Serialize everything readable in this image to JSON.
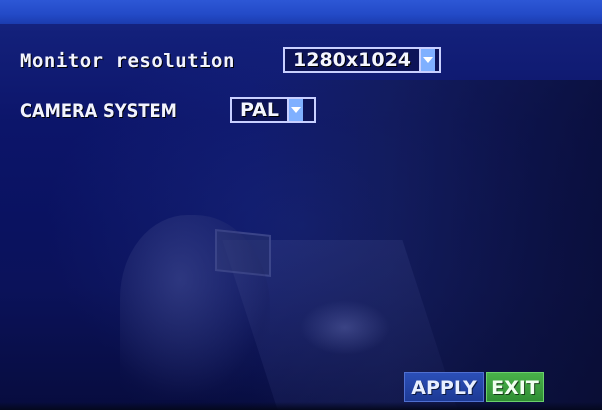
{
  "osd": {
    "monitor_resolution_label": "Monitor resolution",
    "monitor_resolution_value": "1280x1024",
    "camera_system_label": "CAMERA SYSTEM",
    "camera_system_value": "PAL"
  },
  "buttons": {
    "apply_label": "APPLY",
    "exit_label": "EXIT"
  },
  "icons": {
    "dropdown": "chevron-down-icon"
  },
  "colors": {
    "background": "#0c156a",
    "top_bar": "#234ac7",
    "dropdown_arrow": "#7fb0ff",
    "apply_button": "#2b4fb8",
    "exit_button": "#49b24a",
    "text": "#f2f4ff"
  }
}
